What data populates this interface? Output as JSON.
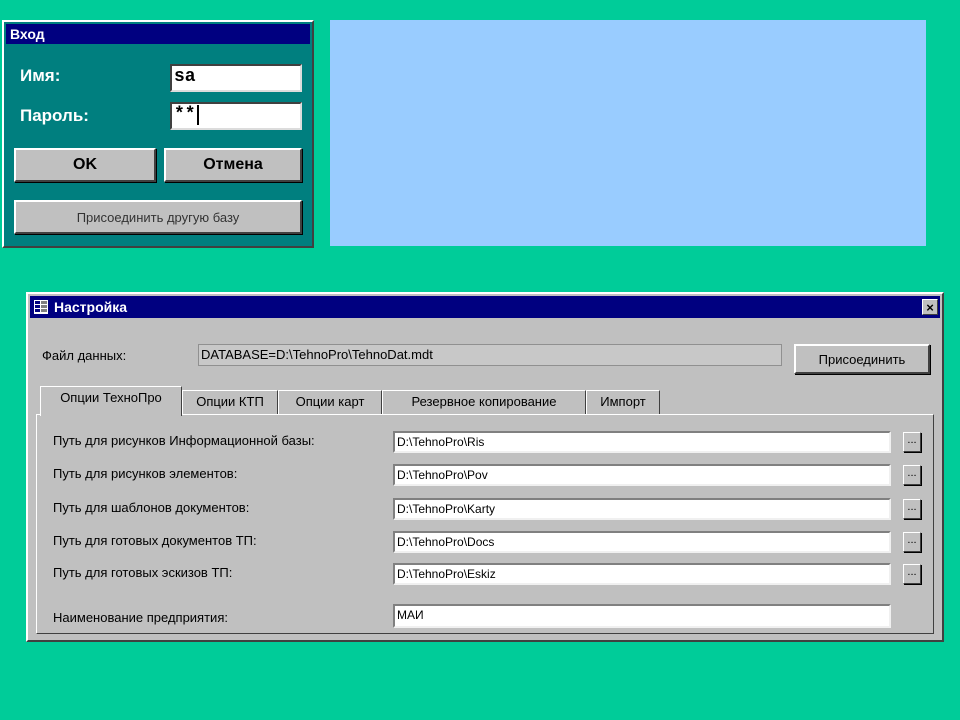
{
  "login": {
    "title": "Вход",
    "name_label": "Имя:",
    "name_value": "sa",
    "password_label": "Пароль:",
    "password_value": "**",
    "ok_label": "OK",
    "cancel_label": "Отмена",
    "attach_db_label": "Присоединить другую базу"
  },
  "settings": {
    "title": "Настройка",
    "close_glyph": "×",
    "data_file_label": "Файл данных:",
    "data_file_value": "DATABASE=D:\\TehnoPro\\TehnoDat.mdt",
    "attach_label": "Присоединить",
    "tabs": [
      "Опции ТехноПро",
      "Опции КТП",
      "Опции карт",
      "Резервное копирование",
      "Импорт"
    ],
    "paths": [
      {
        "label": "Путь для рисунков Информационной базы:",
        "value": "D:\\TehnoPro\\Ris",
        "browse": "..."
      },
      {
        "label": "Путь для рисунков элементов:",
        "value": "D:\\TehnoPro\\Pov",
        "browse": "..."
      },
      {
        "label": "Путь для шаблонов документов:",
        "value": "D:\\TehnoPro\\Karty",
        "browse": "..."
      },
      {
        "label": "Путь для готовых документов ТП:",
        "value": "D:\\TehnoPro\\Docs",
        "browse": "..."
      },
      {
        "label": "Путь для готовых эскизов ТП:",
        "value": "D:\\TehnoPro\\Eskiz",
        "browse": "..."
      }
    ],
    "company_label": "Наименование предприятия:",
    "company_value": "МАИ"
  },
  "colors": {
    "background": "#00cc99",
    "login_bg": "#007f7f",
    "titlebar": "#000080",
    "panel": "#99ccff",
    "dialog": "#c0c0c0"
  }
}
